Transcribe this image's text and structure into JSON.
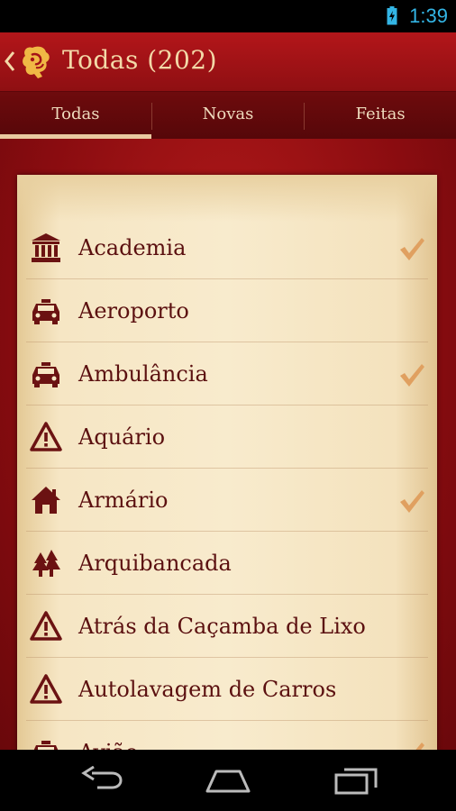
{
  "status_bar": {
    "time": "1:39",
    "icons": [
      "battery-charging-icon"
    ],
    "time_color": "#33b5e5"
  },
  "action_bar": {
    "title": "Todas (202)",
    "icons": [
      "back-icon",
      "app-logo-icon"
    ]
  },
  "tabs": [
    {
      "label": "Todas",
      "selected": true
    },
    {
      "label": "Novas",
      "selected": false
    },
    {
      "label": "Feitas",
      "selected": false
    }
  ],
  "items": [
    {
      "label": "Academia",
      "icon": "bank-building-icon",
      "done": true
    },
    {
      "label": "Aeroporto",
      "icon": "taxi-icon",
      "done": false
    },
    {
      "label": "Ambulância",
      "icon": "taxi-icon",
      "done": true
    },
    {
      "label": "Aquário",
      "icon": "warning-icon",
      "done": false
    },
    {
      "label": "Armário",
      "icon": "house-icon",
      "done": true
    },
    {
      "label": "Arquibancada",
      "icon": "trees-icon",
      "done": false
    },
    {
      "label": "Atrás da Caçamba de Lixo",
      "icon": "warning-icon",
      "done": false
    },
    {
      "label": "Autolavagem de Carros",
      "icon": "warning-icon",
      "done": false
    },
    {
      "label": "Avião",
      "icon": "taxi-icon",
      "done": true
    }
  ],
  "nav_bar": {
    "icons": [
      "back-nav-icon",
      "home-nav-icon",
      "recent-apps-icon"
    ]
  },
  "colors": {
    "action_bar": "#a51317",
    "label_text": "#5b1010",
    "check": "#e0a060",
    "parchment": "#f6e6c4"
  }
}
